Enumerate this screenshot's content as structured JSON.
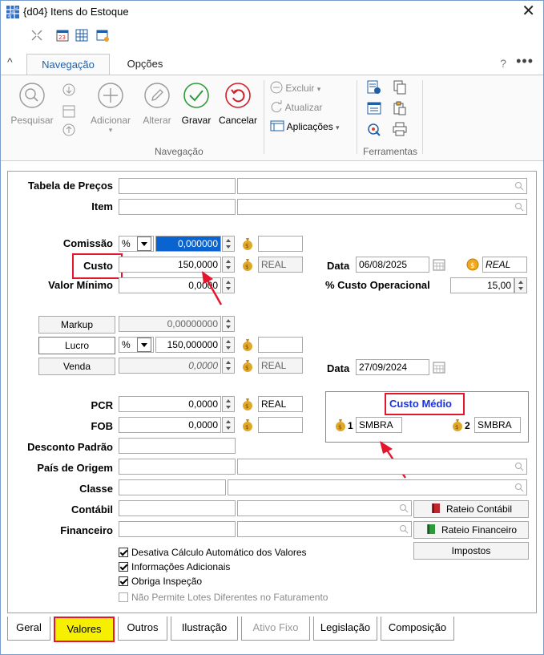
{
  "window": {
    "title": "{d04} Itens do Estoque",
    "close_label": "✕"
  },
  "ribbon_tabs": [
    {
      "label": "Navegação"
    },
    {
      "label": "Opções"
    }
  ],
  "ribbon_extra": {
    "help": "?",
    "more": "•••"
  },
  "ribbon": {
    "buttons": {
      "pesquisar": "Pesquisar",
      "adicionar": "Adicionar",
      "alterar": "Alterar",
      "gravar": "Gravar",
      "cancelar": "Cancelar"
    },
    "small_buttons": {
      "excluir": "Excluir",
      "atualizar": "Atualizar",
      "aplicacoes": "Aplicações"
    },
    "groups": {
      "navegacao": "Navegação",
      "ferramentas": "Ferramentas"
    }
  },
  "form": {
    "tabela_precos": {
      "label": "Tabela de Preços",
      "value": ""
    },
    "item": {
      "label": "Item",
      "value": ""
    },
    "comissao": {
      "label": "Comissão",
      "type": "%",
      "value": "0,000000",
      "extra": ""
    },
    "custo": {
      "label": "Custo",
      "value": "150,0000",
      "currency": "REAL"
    },
    "valor_minimo": {
      "label": "Valor Mínimo",
      "value": "0,0000"
    },
    "data_custo": {
      "label": "Data",
      "value": "06/08/2025",
      "currency": "REAL"
    },
    "custo_operacional": {
      "label": "% Custo Operacional",
      "value": "15,00"
    },
    "markup": {
      "label": "Markup",
      "value": "0,00000000"
    },
    "lucro": {
      "label": "Lucro",
      "type": "%",
      "value": "150,000000",
      "extra": ""
    },
    "venda": {
      "label": "Venda",
      "value": "0,0000",
      "currency": "REAL"
    },
    "data_venda": {
      "label": "Data",
      "value": "27/09/2024"
    },
    "pcr": {
      "label": "PCR",
      "value": "0,0000",
      "currency": "REAL"
    },
    "fob": {
      "label": "FOB",
      "value": "0,0000",
      "currency": ""
    },
    "custo_medio": {
      "title": "Custo Médio",
      "slot1": "1",
      "val1": "SMBRA",
      "slot2": "2",
      "val2": "SMBRA"
    },
    "desconto_padrao": {
      "label": "Desconto Padrão",
      "value": ""
    },
    "pais_origem": {
      "label": "País de Origem",
      "value": ""
    },
    "classe": {
      "label": "Classe",
      "value": ""
    },
    "contabil": {
      "label": "Contábil",
      "value": ""
    },
    "financeiro": {
      "label": "Financeiro",
      "value": ""
    },
    "rateio_contabil": "Rateio Contábil",
    "rateio_financeiro": "Rateio Financeiro",
    "impostos": "Impostos",
    "checks": [
      {
        "label": "Desativa Cálculo Automático dos Valores",
        "checked": true,
        "enabled": true
      },
      {
        "label": "Informações Adicionais",
        "checked": true,
        "enabled": true
      },
      {
        "label": "Obriga Inspeção",
        "checked": true,
        "enabled": true
      },
      {
        "label": "Não Permite Lotes Diferentes no Faturamento",
        "checked": false,
        "enabled": false
      }
    ]
  },
  "bottom_tabs": [
    {
      "label": "Geral"
    },
    {
      "label": "Valores"
    },
    {
      "label": "Outros"
    },
    {
      "label": "Ilustração"
    },
    {
      "label": "Ativo Fixo"
    },
    {
      "label": "Legislação"
    },
    {
      "label": "Composição"
    }
  ],
  "colors": {
    "accent": "#1f5fa6",
    "highlight_red": "#e4162e",
    "highlight_yellow": "#f6f000",
    "custo_medio_text": "#1a33e0"
  }
}
